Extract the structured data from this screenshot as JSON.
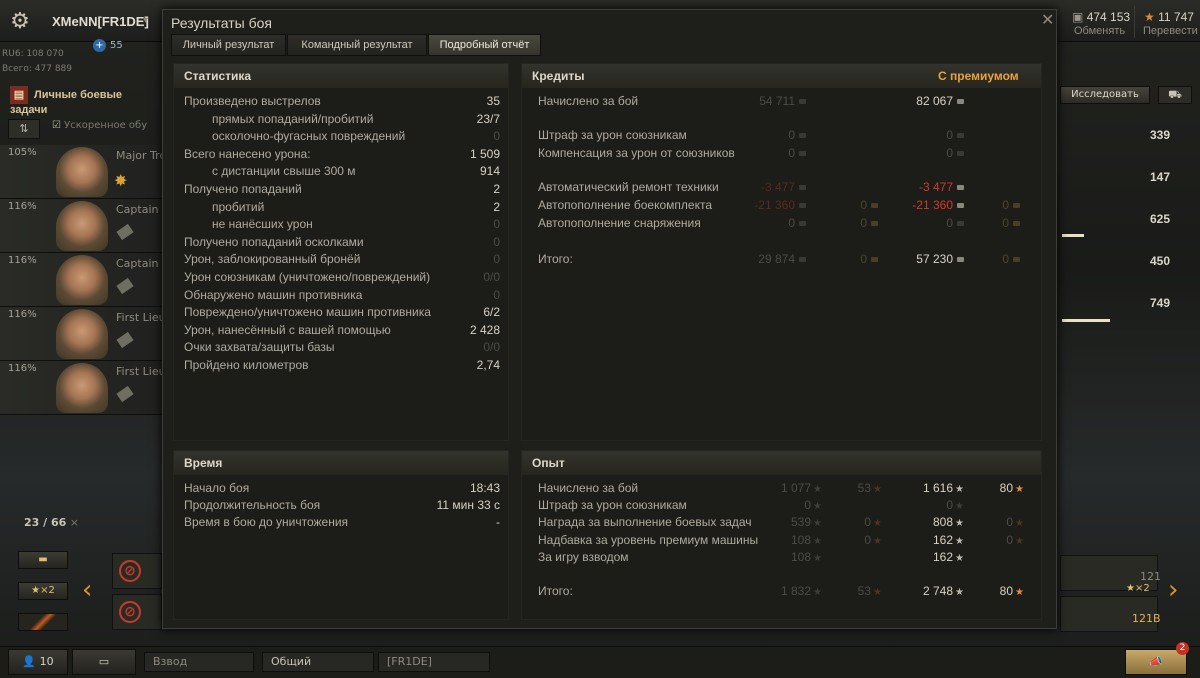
{
  "account": {
    "name": "XMeNN[FR1DE]",
    "clan_points": "55",
    "rating": "RU6: 108 070",
    "total": "Всего: 477 889"
  },
  "currency": {
    "credits": "474 153",
    "credits_action": "Обменять",
    "gold": "11 747",
    "gold_action": "Перевести"
  },
  "quests_label": "Личные боевые задачи",
  "accel_label": "Ускоренное обу",
  "crew": [
    {
      "pct": "105%",
      "rank": "Major Tre"
    },
    {
      "pct": "116%",
      "rank": "Captain S"
    },
    {
      "pct": "116%",
      "rank": "Captain N"
    },
    {
      "pct": "116%",
      "rank": "First Lieu"
    },
    {
      "pct": "116%",
      "rank": "First Lieu"
    }
  ],
  "counter": {
    "value": "23 / 66",
    "x": "×"
  },
  "bottom": {
    "platoon_count": "10",
    "platoon_label": "Взвод",
    "chat_general": "Общий",
    "chat_clan": "[FR1DE]"
  },
  "right": {
    "research": "Исследовать",
    "n1": "339",
    "n2": "147",
    "n3": "625",
    "n4": "450",
    "n5": "749",
    "x2": "×2",
    "n121": "121",
    "n121b": "121В"
  },
  "modal": {
    "title": "Результаты боя",
    "tabs": [
      "Личный результат",
      "Командный результат",
      "Подробный отчёт"
    ],
    "stats": {
      "title": "Статистика",
      "rows": [
        {
          "label": "Произведено выстрелов",
          "value": "35",
          "dim": false,
          "indent": false
        },
        {
          "label": "прямых попаданий/пробитий",
          "value": "23/7",
          "dim": false,
          "indent": true
        },
        {
          "label": "осколочно-фугасных повреждений",
          "value": "0",
          "dim": true,
          "indent": true
        },
        {
          "label": "Всего нанесено урона:",
          "value": "1 509",
          "dim": false,
          "indent": false
        },
        {
          "label": "с дистанции свыше 300 м",
          "value": "914",
          "dim": false,
          "indent": true
        },
        {
          "label": "Получено попаданий",
          "value": "2",
          "dim": false,
          "indent": false
        },
        {
          "label": "пробитий",
          "value": "2",
          "dim": false,
          "indent": true
        },
        {
          "label": "не нанёсших урон",
          "value": "0",
          "dim": true,
          "indent": true
        },
        {
          "label": "Получено попаданий осколками",
          "value": "0",
          "dim": true,
          "indent": false
        },
        {
          "label": "Урон, заблокированный бронёй",
          "value": "0",
          "dim": true,
          "indent": false
        },
        {
          "label": "Урон союзникам (уничтожено/повреждений)",
          "value": "0/0",
          "dim": true,
          "indent": false
        },
        {
          "label": "Обнаружено машин противника",
          "value": "0",
          "dim": true,
          "indent": false
        },
        {
          "label": "Повреждено/уничтожено машин противника",
          "value": "6/2",
          "dim": false,
          "indent": false
        },
        {
          "label": "Урон, нанесённый с вашей помощью",
          "value": "2 428",
          "dim": false,
          "indent": false
        },
        {
          "label": "Очки захвата/защиты базы",
          "value": "0/0",
          "dim": true,
          "indent": false
        },
        {
          "label": "Пройдено километров",
          "value": "2,74",
          "dim": false,
          "indent": false
        }
      ]
    },
    "credits": {
      "title": "Кредиты",
      "premium": "С премиумом",
      "rows": [
        {
          "label": "Начислено за бой",
          "c1": "54 711",
          "g1": "",
          "c2": "82 067",
          "g2": "",
          "style": "normal"
        },
        {
          "label": "Штраф за урон союзникам",
          "c1": "0",
          "g1": "",
          "c2": "0",
          "g2": "",
          "style": "dim"
        },
        {
          "label": "Компенсация за урон от союзников",
          "c1": "0",
          "g1": "",
          "c2": "0",
          "g2": "",
          "style": "dim"
        },
        {
          "label": "Автоматический ремонт техники",
          "c1": "-3 477",
          "g1": "",
          "c2": "-3 477",
          "g2": "",
          "style": "red"
        },
        {
          "label": "Автопополнение боекомплекта",
          "c1": "-21 360",
          "g1": "0",
          "c2": "-21 360",
          "g2": "0",
          "style": "red"
        },
        {
          "label": "Автопополнение снаряжения",
          "c1": "0",
          "g1": "0",
          "c2": "0",
          "g2": "0",
          "style": "dim"
        },
        {
          "label": "Итого:",
          "c1": "29 874",
          "g1": "0",
          "c2": "57 230",
          "g2": "0",
          "style": "total"
        }
      ]
    },
    "time": {
      "title": "Время",
      "rows": [
        {
          "label": "Начало боя",
          "value": "18:43"
        },
        {
          "label": "Продолжительность боя",
          "value": "11 мин 33 с"
        },
        {
          "label": "Время в бою до уничтожения",
          "value": "-"
        }
      ]
    },
    "exp": {
      "title": "Опыт",
      "rows": [
        {
          "label": "Начислено за бой",
          "x1": "1 077",
          "f1": "53",
          "x2": "1 616",
          "f2": "80"
        },
        {
          "label": "Штраф за урон союзникам",
          "x1": "0",
          "f1": "",
          "x2": "0",
          "f2": ""
        },
        {
          "label": "Награда за выполнение боевых задач",
          "x1": "539",
          "f1": "0",
          "x2": "808",
          "f2": "0"
        },
        {
          "label": "Надбавка за уровень премиум машины",
          "x1": "108",
          "f1": "0",
          "x2": "162",
          "f2": "0"
        },
        {
          "label": "За игру взводом",
          "x1": "108",
          "f1": "",
          "x2": "162",
          "f2": ""
        },
        {
          "label": "Итого:",
          "x1": "1 832",
          "f1": "53",
          "x2": "2 748",
          "f2": "80"
        }
      ]
    }
  }
}
